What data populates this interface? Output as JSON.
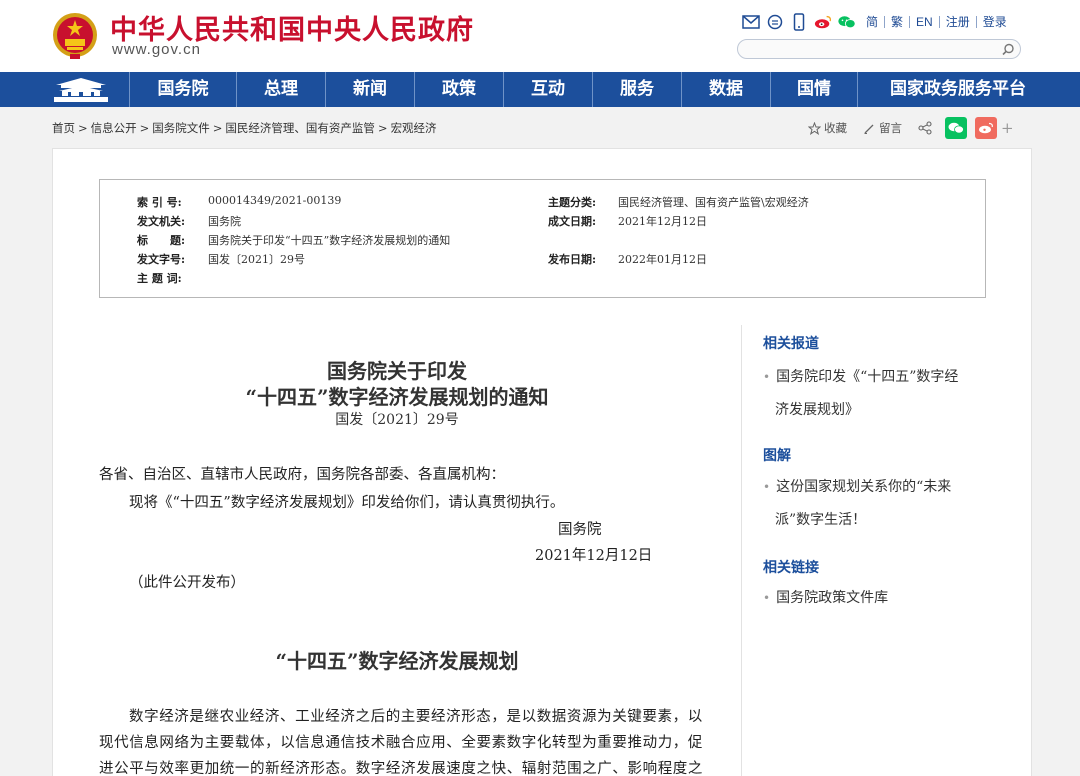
{
  "header": {
    "site_name": "中华人民共和国中央人民政府",
    "site_url": "www.gov.cn",
    "lang_simplified": "简",
    "lang_traditional": "繁",
    "lang_english": "EN",
    "register": "注册",
    "login": "登录",
    "search_placeholder": ""
  },
  "nav": {
    "items": [
      "国务院",
      "总理",
      "新闻",
      "政策",
      "互动",
      "服务",
      "数据",
      "国情",
      "国家政务服务平台"
    ]
  },
  "breadcrumb": {
    "items": [
      "首页",
      "信息公开",
      "国务院文件",
      "国民经济管理、国有资产监管",
      "宏观经济"
    ]
  },
  "actions": {
    "favorite": "收藏",
    "comment": "留言"
  },
  "meta": {
    "index_label": "索 引 号:",
    "index_value": "000014349/2021-00139",
    "topic_label": "主题分类:",
    "topic_value": "国民经济管理、国有资产监管\\宏观经济",
    "issuer_label": "发文机关:",
    "issuer_value": "国务院",
    "date_written_label": "成文日期:",
    "date_written_value": "2021年12月12日",
    "title_label": "标　　题:",
    "title_value": "国务院关于印发“十四五”数字经济发展规划的通知",
    "doc_no_label": "发文字号:",
    "doc_no_value": "国发〔2021〕29号",
    "publish_label": "发布日期:",
    "publish_value": "2022年01月12日",
    "keyword_label": "主 题 词:",
    "keyword_value": ""
  },
  "article": {
    "title_line1": "国务院关于印发",
    "title_line2": "“十四五”数字经济发展规划的通知",
    "doc_number": "国发〔2021〕29号",
    "addressee": "各省、自治区、直辖市人民政府，国务院各部委、各直属机构：",
    "instruction": "现将《“十四五”数字经济发展规划》印发给你们，请认真贯彻执行。",
    "signature": "国务院",
    "sign_date": "2021年12月12日",
    "public_note": "（此件公开发布）",
    "plan_title": "“十四五”数字经济发展规划",
    "body_line1": "数字经济是继农业经济、工业经济之后的主要经济形态，是以数据资源为关键要素，以",
    "body_line2": "现代信息网络为主要载体，以信息通信技术融合应用、全要素数字化转型为重要推动力，促",
    "body_line3": "进公平与效率更加统一的新经济形态。数字经济发展速度之快、辐射范围之广、影响程度之"
  },
  "sidebar": {
    "related_reports": "相关报道",
    "report_link_line1": "国务院印发《“十四五”数字经",
    "report_link_line2": "济发展规划》",
    "graphics": "图解",
    "graphic_link_line1": "这份国家规划关系你的“未来",
    "graphic_link_line2": "派”数字生活！",
    "related_links": "相关链接",
    "library_link": "国务院政策文件库"
  },
  "colors": {
    "brand_red": "#c8102e",
    "nav_blue": "#1c4f9c",
    "wechat_green": "#07c160",
    "weibo_red": "#f06b5f"
  }
}
